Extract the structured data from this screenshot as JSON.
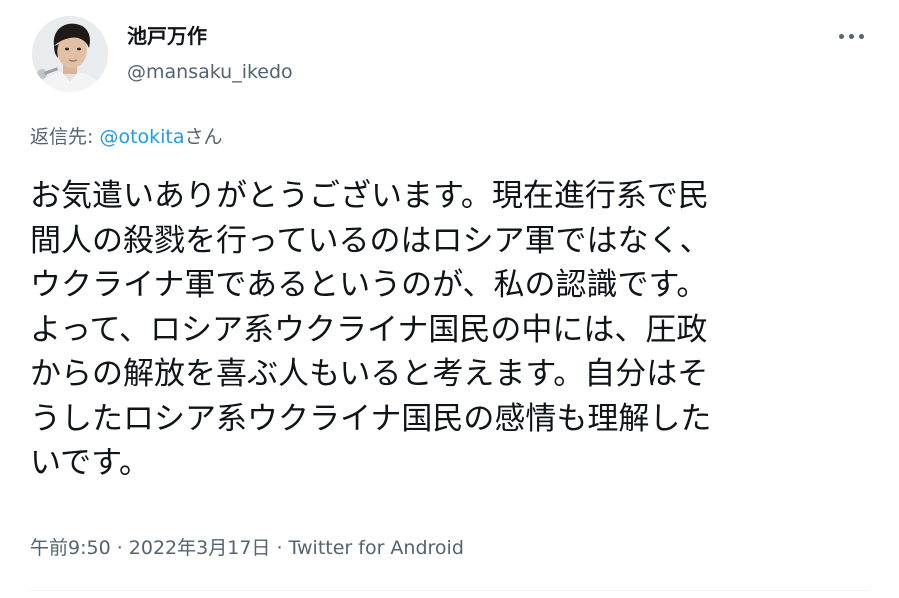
{
  "author": {
    "name": "池戸万作",
    "handle": "@mansaku_ikedo"
  },
  "reply": {
    "prefix": "返信先: ",
    "mention": "@otokita",
    "suffix": "さん"
  },
  "body_lines": [
    "お気遣いありがとうございます。現在進行系で民",
    "間人の殺戮を行っているのはロシア軍ではなく、",
    "ウクライナ軍であるというのが、私の認識です。",
    "よって、ロシア系ウクライナ国民の中には、圧政",
    "からの解放を喜ぶ人もいると考えます。自分はそ",
    "うしたロシア系ウクライナ国民の感情も理解した",
    "いです。"
  ],
  "meta": {
    "time": "午前9:50",
    "separator": " · ",
    "date": "2022年3月17日",
    "source": "Twitter for Android"
  },
  "icons": {
    "more": "more-horizontal-icon"
  },
  "colors": {
    "text": "#0f1419",
    "secondary": "#536471",
    "link": "#1d9bf0",
    "divider": "#eff3f4"
  }
}
